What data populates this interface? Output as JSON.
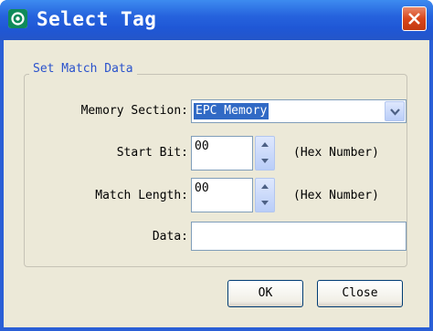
{
  "window": {
    "title": "Select Tag"
  },
  "group": {
    "title": "Set Match Data"
  },
  "memory_section": {
    "label": "Memory Section:",
    "value": "EPC Memory"
  },
  "start_bit": {
    "label": "Start Bit:",
    "value": "00",
    "hint": "(Hex Number)"
  },
  "match_length": {
    "label": "Match Length:",
    "value": "00",
    "hint": "(Hex Number)"
  },
  "data_field": {
    "label": "Data:",
    "value": ""
  },
  "buttons": {
    "ok": "OK",
    "close": "Close"
  },
  "icons": {
    "app": "app-logo-icon",
    "close": "close-icon"
  },
  "colors": {
    "titlebar": "#2663dd",
    "close_button": "#d9461b",
    "group_title": "#2a52cc",
    "selection": "#316ac5"
  }
}
